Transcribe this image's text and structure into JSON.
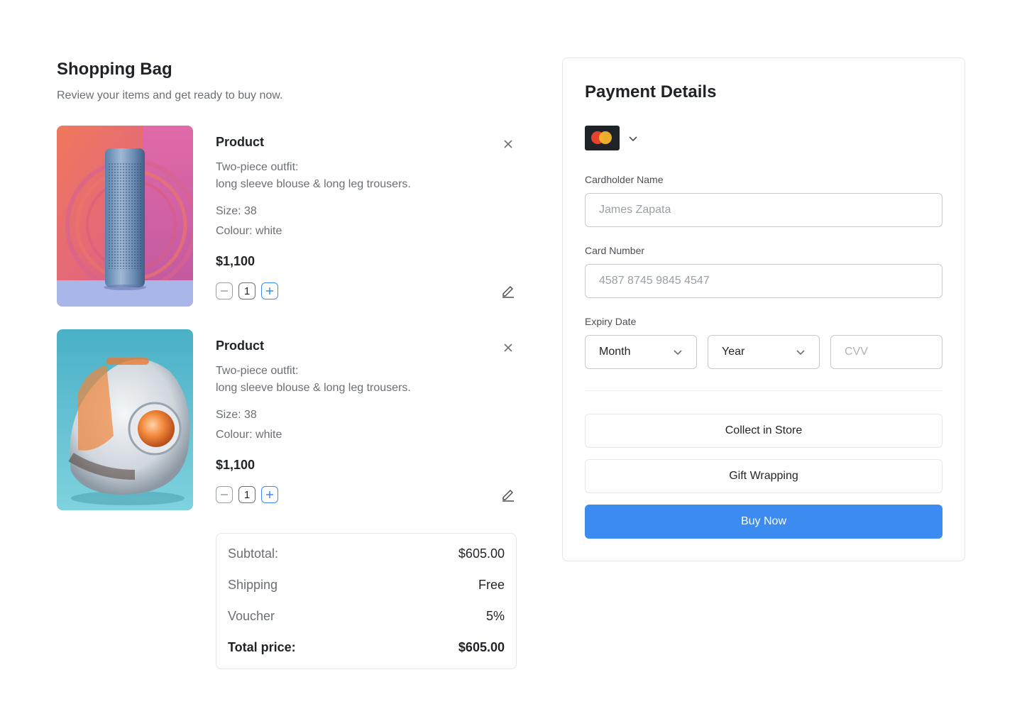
{
  "bag": {
    "title": "Shopping Bag",
    "subtitle": "Review your items and get ready to buy now."
  },
  "items": [
    {
      "title": "Product",
      "desc_line1": "Two-piece outfit:",
      "desc_line2": "long sleeve blouse & long leg trousers.",
      "size": "Size: 38",
      "colour": "Colour: white",
      "price": "$1,100",
      "quantity": "1"
    },
    {
      "title": "Product",
      "desc_line1": "Two-piece outfit:",
      "desc_line2": "long sleeve blouse & long leg trousers.",
      "size": "Size: 38",
      "colour": "Colour: white",
      "price": "$1,100",
      "quantity": "1"
    }
  ],
  "summary": {
    "subtotal_label": "Subtotal:",
    "subtotal_value": "$605.00",
    "shipping_label": "Shipping",
    "shipping_value": "Free",
    "voucher_label": "Voucher",
    "voucher_value": "5%",
    "total_label": "Total price:",
    "total_value": "$605.00"
  },
  "payment": {
    "title": "Payment Details",
    "card_icon": "mastercard-icon",
    "cardholder_label": "Cardholder Name",
    "cardholder_placeholder": "James Zapata",
    "card_number_label": "Card Number",
    "card_number_placeholder": "4587 8745 9845 4547",
    "expiry_label": "Expiry Date",
    "month_value": "Month",
    "year_value": "Year",
    "cvv_placeholder": "CVV",
    "collect_label": "Collect in Store",
    "gift_label": "Gift Wrapping",
    "buy_label": "Buy Now"
  },
  "colors": {
    "accent": "#3b8bf0",
    "text": "#1f2328",
    "muted": "#6b6f75",
    "border": "#e5e7eb"
  }
}
